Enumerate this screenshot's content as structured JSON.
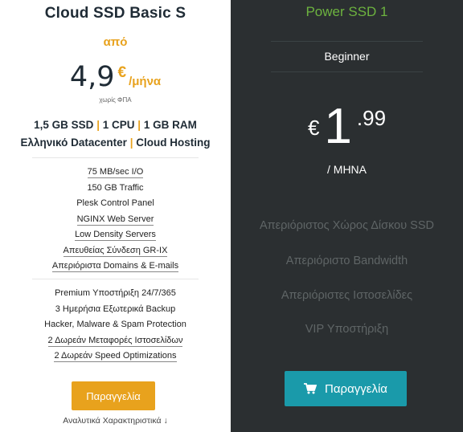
{
  "left_plan": {
    "title": "Cloud SSD Basic S",
    "from_label": "από",
    "price": "4,9",
    "currency": "€",
    "period": "/μήνα",
    "vat_note": "χωρίς ΦΠΑ",
    "spec_line1": [
      "1,5 GB SSD",
      "1 CPU",
      "1 GB RAM"
    ],
    "spec_line2": [
      "Ελληνικό Datacenter",
      "Cloud Hosting"
    ],
    "spec_separator": "|",
    "features_group1": [
      "75 MB/sec I/O",
      "150 GB Traffic",
      "Plesk Control Panel",
      "NGINX Web Server",
      "Low Density Servers",
      "Απευθείας Σύνδεση GR-IX",
      "Απεριόριστα Domains & E-mails"
    ],
    "features_group2": [
      "Premium Υποστήριξη 24/7/365",
      "3 Ημερήσια Εξωτερικά Backup",
      "Hacker, Malware & Spam Protection",
      "2 Δωρεάν Μεταφορές Ιστοσελίδων",
      "2 Δωρεάν Speed Optimizations"
    ],
    "order_label": "Παραγγελία",
    "details_label": "Αναλυτικά Χαρακτηριστικά ↓"
  },
  "right_plan": {
    "title": "Power SSD 1",
    "level": "Beginner",
    "currency": "€",
    "price_int": "1",
    "price_dec": ".99",
    "period": "/ ΜΗΝΑ",
    "features": [
      "Απεριόριστος Χώρος Δίσκου SSD",
      "Απεριόριστο Bandwidth",
      "Απεριόριστες Ιστοσελίδες",
      "VIP Υποστήριξη"
    ],
    "order_label": "Παραγγελία",
    "order_icon": "cart-icon"
  },
  "colors": {
    "accent_orange": "#e8a21d",
    "accent_green": "#6db33f",
    "button_teal": "#1a9aaa",
    "dark_panel": "#2b2f31"
  }
}
